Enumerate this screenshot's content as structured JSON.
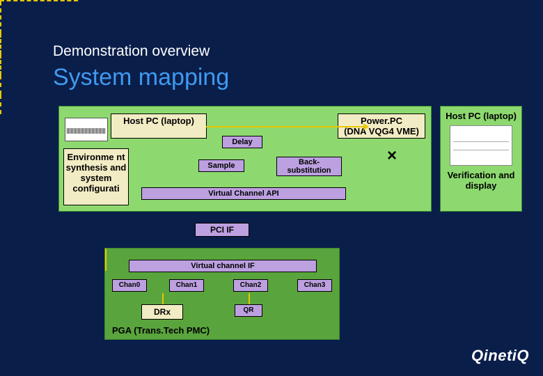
{
  "headings": {
    "small": "Demonstration overview",
    "large": "System mapping"
  },
  "top_panel": {
    "host_pc": "Host PC (laptop)",
    "power_pc_line1": "Power.PC",
    "power_pc_line2": "(DNA VQG4 VME)",
    "env_synth": "Environme nt synthesis and system configurati",
    "delay": "Delay",
    "sample": "Sample",
    "backsub": "Back- substitution",
    "vc_api": "Virtual Channel API",
    "x_mark": "×"
  },
  "connector": {
    "pci_if": "PCI IF"
  },
  "bottom_panel": {
    "vc_if": "Virtual channel IF",
    "channels": [
      "Chan0",
      "Chan1",
      "Chan2",
      "Chan3"
    ],
    "drx": "DRx",
    "qr": "QR",
    "pga": "PGA (Trans.Tech PMC)"
  },
  "right_panel": {
    "host_pc": "Host PC (laptop)",
    "verif": "Verification and display"
  },
  "branding": {
    "logo": "QinetiQ"
  }
}
